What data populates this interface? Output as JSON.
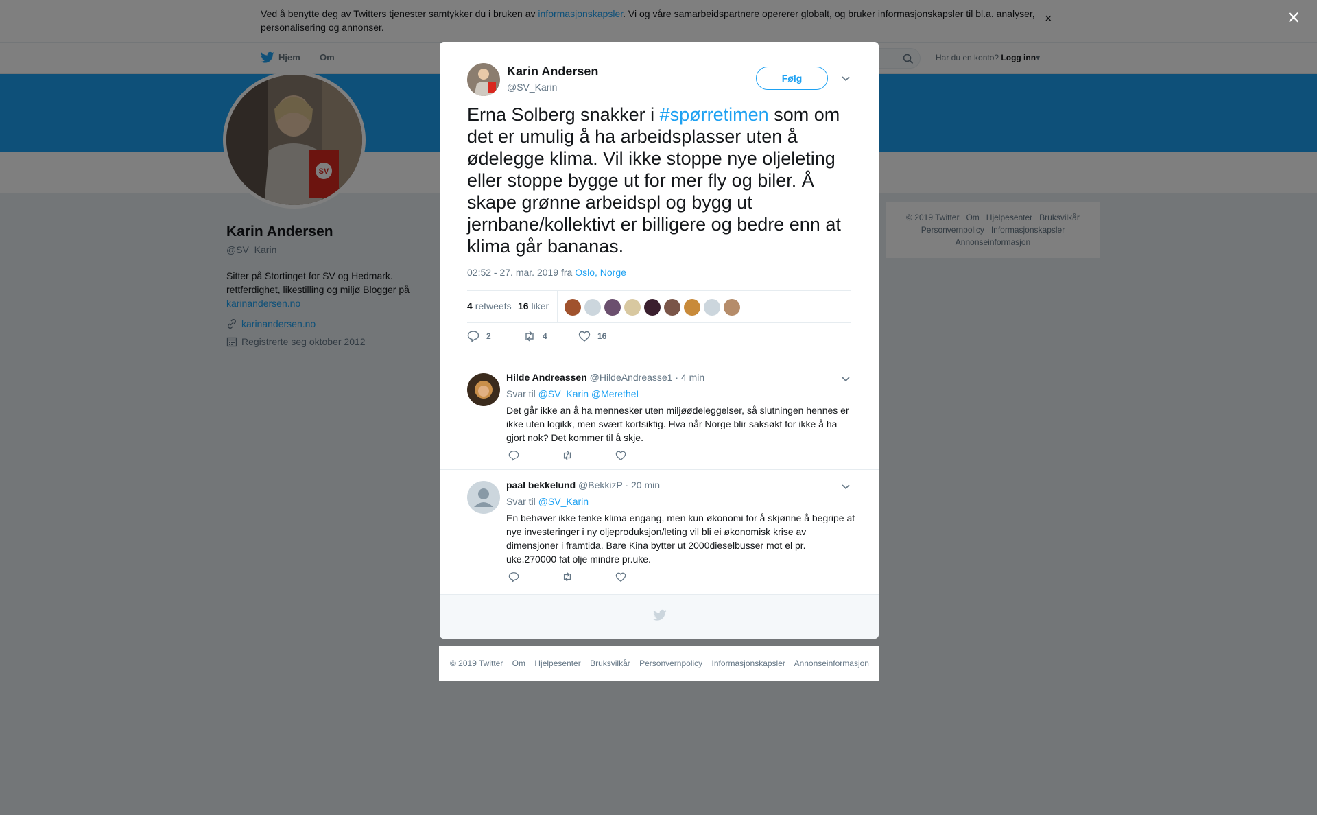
{
  "cookie_banner": {
    "text_before": "Ved å benytte deg av Twitters tjenester samtykker du i bruken av ",
    "link": "informasjonskapsler",
    "text_after": ". Vi og våre samarbeidspartnere opererer globalt, og bruker informasjonskapsler til bl.a. analyser, personalisering og annonser.",
    "close": "×"
  },
  "nav": {
    "home": "Hjem",
    "about": "Om",
    "login_prompt": "Har du en konto?",
    "login": "Logg inn"
  },
  "profile": {
    "name": "Karin Andersen",
    "handle": "@SV_Karin",
    "bio": "Sitter på Stortinget for SV og Hedmark. rettferdighet, likestilling og miljø Blogger på",
    "bio_link": "karinandersen.no",
    "website": "karinandersen.no",
    "joined": "Registrerte seg oktober 2012"
  },
  "side_footer": [
    "© 2019 Twitter",
    "Om",
    "Hjelpesenter",
    "Bruksvilkår",
    "Personvernpolicy",
    "Informasjonskapsler",
    "Annonseinformasjon"
  ],
  "modal_close": "×",
  "tweet": {
    "author_name": "Karin Andersen",
    "author_handle": "@SV_Karin",
    "follow_label": "Følg",
    "text_before": "Erna Solberg snakker i ",
    "hashtag": "#spørretimen",
    "text_after": " som om det er umulig å ha arbeidsplasser uten å ødelegge klima. Vil ikke stoppe nye oljeleting eller stoppe bygge ut for mer fly og biler.  Å skape grønne arbeidspl og bygg ut jernbane/kollektivt er billigere og bedre enn at klima går bananas.",
    "timestamp": "02:52 - 27. mar. 2019 fra ",
    "location": "Oslo, Norge",
    "retweets_count": "4",
    "retweets_label": "retweets",
    "likes_count": "16",
    "likes_label": "liker",
    "reply_count": "2",
    "retweet_count": "4",
    "like_count": "16",
    "liker_colors": [
      "#a0522d",
      "#ccd6dd",
      "#6b4f6e",
      "#d8c8a0",
      "#3a1f2e",
      "#7a5548",
      "#c88a3a",
      "#ccd6dd",
      "#b58c6a"
    ]
  },
  "replies": [
    {
      "name": "Hilde Andreassen",
      "handle": "@HildeAndreasse1",
      "time": "· 4 min",
      "reply_to_label": "Svar til",
      "reply_to": [
        "@SV_Karin",
        "@MeretheL"
      ],
      "text": "Det går ikke an å ha mennesker uten miljøødeleggelser, så slutningen hennes er ikke uten logikk, men svært kortsiktig. Hva når Norge blir saksøkt for ikke å ha gjort nok? Det kommer til å skje."
    },
    {
      "name": "paal bekkelund",
      "handle": "@BekkizP",
      "time": "· 20 min",
      "reply_to_label": "Svar til",
      "reply_to": [
        "@SV_Karin"
      ],
      "text": "En behøver ikke tenke klima engang, men kun økonomi for å skjønne å begripe at nye investeringer i ny oljeproduksjon/leting vil bli ei økonomisk krise av dimensjoner i framtida. Bare Kina bytter ut 2000dieselbusser mot el pr. uke.270000 fat olje mindre pr.uke."
    }
  ],
  "page_footer": [
    "© 2019 Twitter",
    "Om",
    "Hjelpesenter",
    "Bruksvilkår",
    "Personvernpolicy",
    "Informasjonskapsler",
    "Annonseinformasjon"
  ]
}
